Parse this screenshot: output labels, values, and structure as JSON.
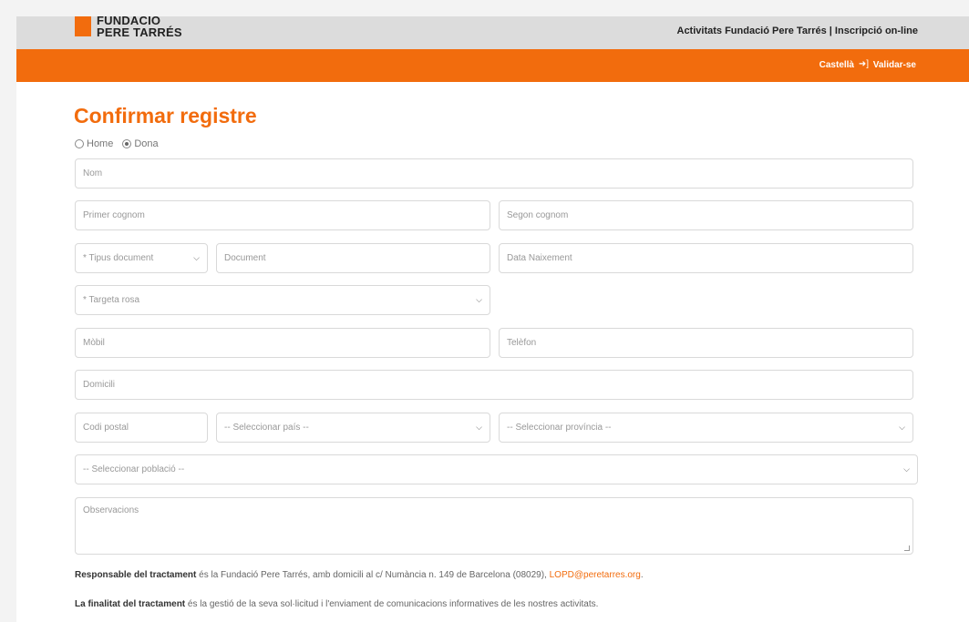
{
  "header": {
    "logo_line1": "FUNDACIO",
    "logo_line2": "PERE TARRÉS",
    "site_title": "Activitats Fundació Pere Tarrés | Inscripció on-line"
  },
  "nav": {
    "language": "Castellà",
    "login_icon": "login-arrow-icon",
    "login": "Validar-se"
  },
  "form": {
    "title": "Confirmar registre",
    "gender": {
      "options": [
        "Home",
        "Dona"
      ],
      "selected": "Dona"
    },
    "nom_placeholder": "Nom",
    "primer_cognom_placeholder": "Primer cognom",
    "segon_cognom_placeholder": "Segon cognom",
    "tipus_document": "* Tipus document",
    "document_placeholder": "Document",
    "data_naixement_placeholder": "Data Naixement",
    "targeta_rosa": "* Targeta rosa",
    "mobil_placeholder": "Mòbil",
    "telefon_placeholder": "Telèfon",
    "domicili_placeholder": "Domicili",
    "codi_postal_placeholder": "Codi postal",
    "pais": "-- Seleccionar país --",
    "provincia": "-- Seleccionar província --",
    "poblacio": "-- Seleccionar població --",
    "observacions_placeholder": "Observacions"
  },
  "legal": {
    "p1_bold": "Responsable del tractament",
    "p1_text": " és la Fundació Pere Tarrés, amb domicili al c/ Numància n. 149 de Barcelona (08029), ",
    "p1_link": "LOPD@peretarres.org",
    "p1_end": ".",
    "p2_bold": "La finalitat del tractament",
    "p2_text": " és la gestió de la seva sol·licitud i l'enviament de comunicacions informatives de les nostres activitats."
  },
  "colors": {
    "brand": "#f26c0d",
    "topbar": "#dcdcdc"
  }
}
